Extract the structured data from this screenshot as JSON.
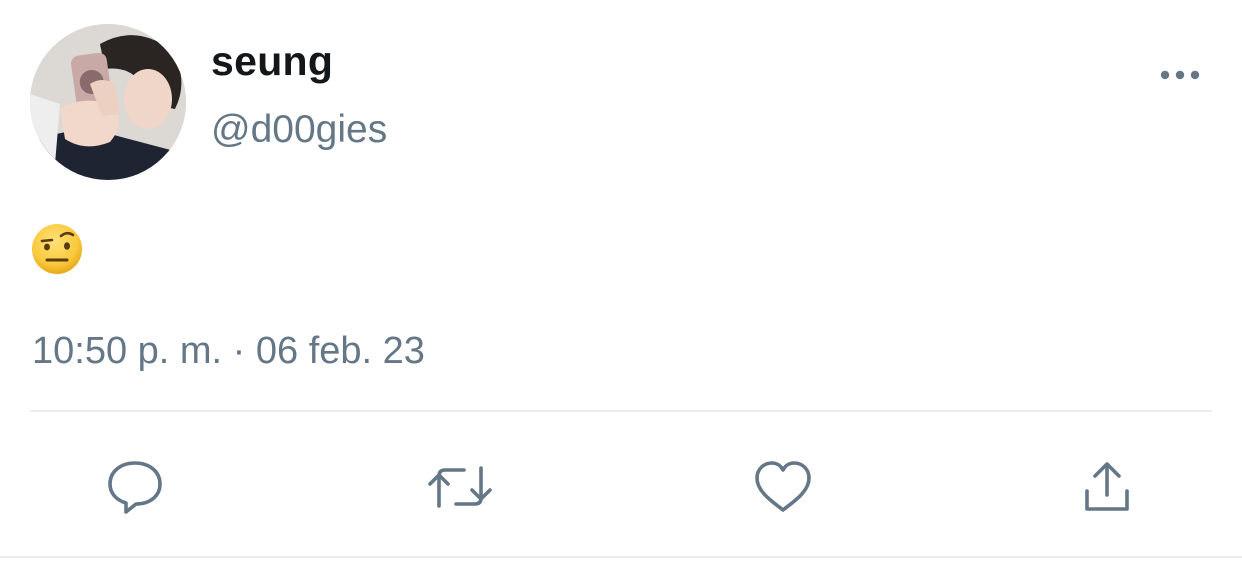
{
  "tweet": {
    "author": {
      "display_name": "seung",
      "handle": "@d00gies"
    },
    "content": {
      "emoji_name": "face with raised eyebrow"
    },
    "timestamp": "10:50 p. m. · 06 feb. 23"
  },
  "actions": {
    "reply_icon": "reply-icon",
    "retweet_icon": "retweet-icon",
    "like_icon": "heart-icon",
    "share_icon": "share-icon"
  },
  "colors": {
    "text_primary": "#14171a",
    "text_secondary": "#657786",
    "icon": "#657786",
    "divider": "#e6ecf0",
    "emoji_yellow": "#f9c93c"
  }
}
